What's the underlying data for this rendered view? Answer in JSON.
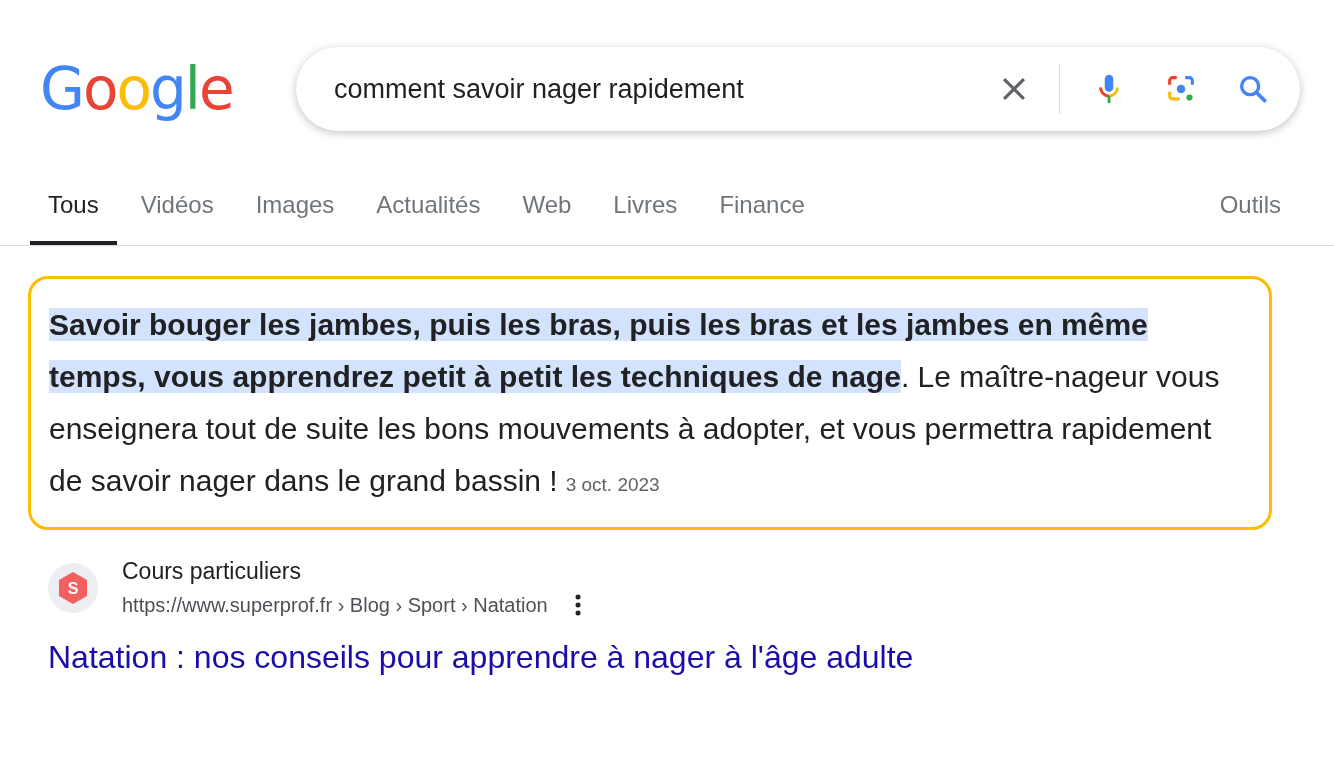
{
  "logo": {
    "text": "Google"
  },
  "search": {
    "value": "comment savoir nager rapidement"
  },
  "tabs": [
    {
      "label": "Tous",
      "selected": true
    },
    {
      "label": "Vidéos",
      "selected": false
    },
    {
      "label": "Images",
      "selected": false
    },
    {
      "label": "Actualités",
      "selected": false
    },
    {
      "label": "Web",
      "selected": false
    },
    {
      "label": "Livres",
      "selected": false
    },
    {
      "label": "Finance",
      "selected": false
    }
  ],
  "tools": "Outils",
  "snippet": {
    "highlighted": "Savoir bouger les jambes, puis les bras, puis les bras et les jambes en même temps, vous apprendrez petit à petit les techniques de nage",
    "text": ". Le maître-nageur vous enseignera tout de suite les bons mouvements à adopter, et vous permettra rapidement de savoir nager dans le grand bassin !",
    "date": "3 oct. 2023"
  },
  "result": {
    "favicon": "S",
    "site": "Cours particuliers",
    "url": "https://www.superprof.fr › Blog › Sport › Natation",
    "title": "Natation : nos conseils pour apprendre à nager à l'âge adulte"
  }
}
